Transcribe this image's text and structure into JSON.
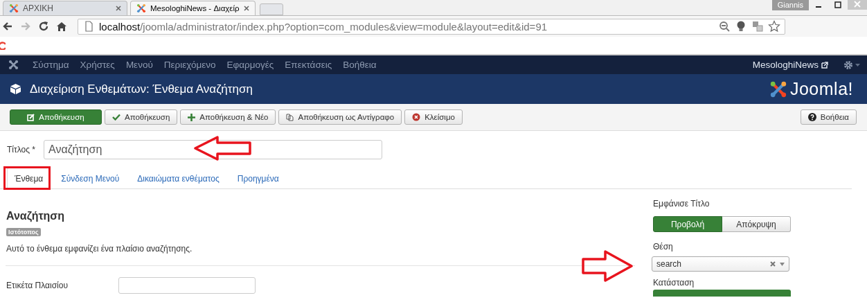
{
  "browser": {
    "tabs": [
      {
        "label": "ΑΡΧΙΚΗ",
        "selected": false
      },
      {
        "label": "MesologhiNews - Διαχείρ",
        "selected": true
      }
    ],
    "profile": "Giannis",
    "url_host": "localhost",
    "url_path": "/joomla/administrator/index.php?option=com_modules&view=module&layout=edit&id=91"
  },
  "navbar": {
    "menu": [
      "Σύστημα",
      "Χρήστες",
      "Μενού",
      "Περιεχόμενο",
      "Εφαρμογές",
      "Επεκτάσεις",
      "Βοήθεια"
    ],
    "site_link": "MesologhiNews"
  },
  "header": {
    "title": "Διαχείριση Ενθεμάτων: Ένθεμα Αναζήτηση",
    "logo": "Joomla!"
  },
  "toolbar": {
    "buttons": [
      {
        "label": "Αποθήκευση",
        "kind": "primary"
      },
      {
        "label": "Αποθήκευση",
        "kind": "check"
      },
      {
        "label": "Αποθήκευση & Νέο",
        "kind": "plus"
      },
      {
        "label": "Αποθήκευση ως Αντίγραφο",
        "kind": "copy"
      },
      {
        "label": "Κλείσιμο",
        "kind": "close"
      }
    ],
    "help": "Βοήθεια"
  },
  "title_field": {
    "label": "Τίτλος *",
    "value": "Αναζήτηση"
  },
  "tabs": [
    {
      "label": "Ένθεμα",
      "selected": true
    },
    {
      "label": "Σύνδεση Μενού",
      "selected": false
    },
    {
      "label": "Δικαιώματα ενθέματος",
      "selected": false
    },
    {
      "label": "Προηγμένα",
      "selected": false
    }
  ],
  "module": {
    "name": "Αναζήτηση",
    "badge": "Ιστότοπος",
    "description": "Αυτό το ένθεμα εμφανίζει ένα πλαίσιο αναζήτησης.",
    "fields": [
      {
        "label": "Ετικέτα Πλαισίου"
      }
    ]
  },
  "sidebar": {
    "show_title": {
      "label": "Εμφάνισε Τίτλο",
      "options": [
        {
          "label": "Προβολή",
          "selected": true
        },
        {
          "label": "Απόκρυψη",
          "selected": false
        }
      ]
    },
    "position": {
      "label": "Θέση",
      "value": "search"
    },
    "status": {
      "label": "Κατάσταση"
    }
  },
  "annotations": [
    {
      "kind": "left-arrow"
    },
    {
      "kind": "tab-frame"
    },
    {
      "kind": "right-arrow"
    }
  ]
}
